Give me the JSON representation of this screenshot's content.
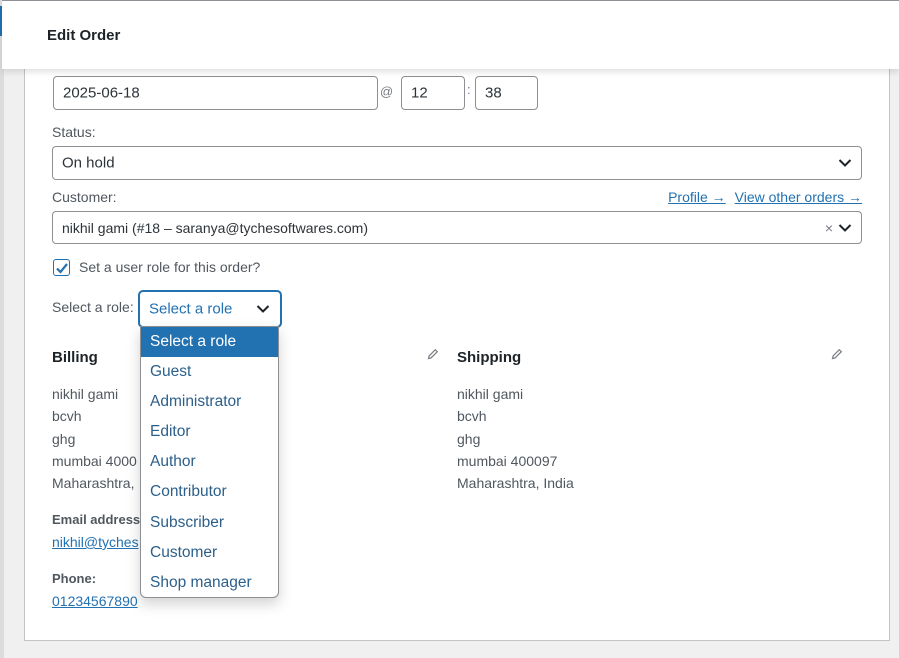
{
  "modal": {
    "title": "Edit Order"
  },
  "order": {
    "date": "2025-06-18",
    "at": "@",
    "hour": "12",
    "colon": ":",
    "minute": "38",
    "status_label": "Status:",
    "status_value": "On hold",
    "customer_label": "Customer:",
    "profile_link": "Profile →",
    "other_orders_link": "View other orders →",
    "customer_value": "nikhil gami (#18 – saranya@tychesoftwares.com)",
    "clear": "×",
    "role_checkbox_label": "Set a user role for this order?",
    "role_checked": true,
    "role_label": "Select a role:",
    "role_value": "Select a role"
  },
  "role_options": [
    "Select a role",
    "Guest",
    "Administrator",
    "Editor",
    "Author",
    "Contributor",
    "Subscriber",
    "Customer",
    "Shop manager"
  ],
  "billing": {
    "heading": "Billing",
    "lines": [
      "nikhil gami",
      "bcvh",
      "ghg",
      "mumbai 4000",
      "Maharashtra,"
    ],
    "email_label": "Email address",
    "email": "nikhil@tyches",
    "phone_label": "Phone:",
    "phone": "01234567890"
  },
  "shipping": {
    "heading": "Shipping",
    "lines": [
      "nikhil gami",
      "bcvh",
      "ghg",
      "mumbai 400097",
      "Maharashtra, India"
    ]
  },
  "icons": {
    "chevron": "chevron-down-icon",
    "pencil": "pencil-icon",
    "check": "checkmark-icon"
  },
  "colors": {
    "accent": "#2271b1",
    "border": "#8c8f94",
    "text": "#2c3338"
  }
}
